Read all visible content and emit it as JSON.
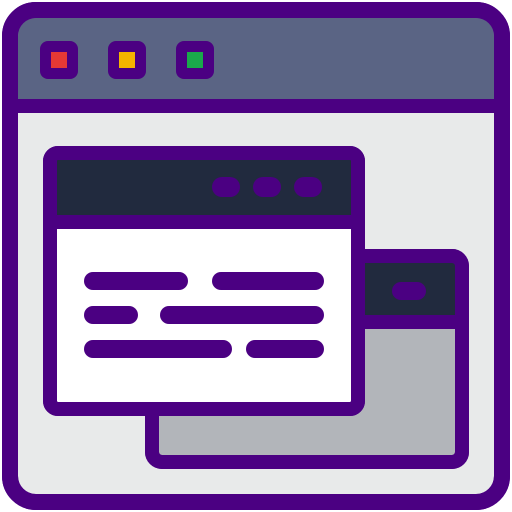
{
  "icon": {
    "name": "browser-windows-icon",
    "colors": {
      "outline": "#4B0082",
      "titlebar": "#5A6484",
      "window_body": "#E8EAEA",
      "inner_bar": "#212A3E",
      "content_white": "#FFFFFF",
      "back_window_body": "#B2B5BA",
      "dot_red": "#E53935",
      "dot_yellow": "#F5B400",
      "dot_green": "#1AA84B",
      "text_lines": "#4B0082"
    },
    "window_controls": [
      {
        "name": "close-dot-icon",
        "color": "dot_red"
      },
      {
        "name": "minimize-dot-icon",
        "color": "dot_yellow"
      },
      {
        "name": "maximize-dot-icon",
        "color": "dot_green"
      }
    ]
  }
}
